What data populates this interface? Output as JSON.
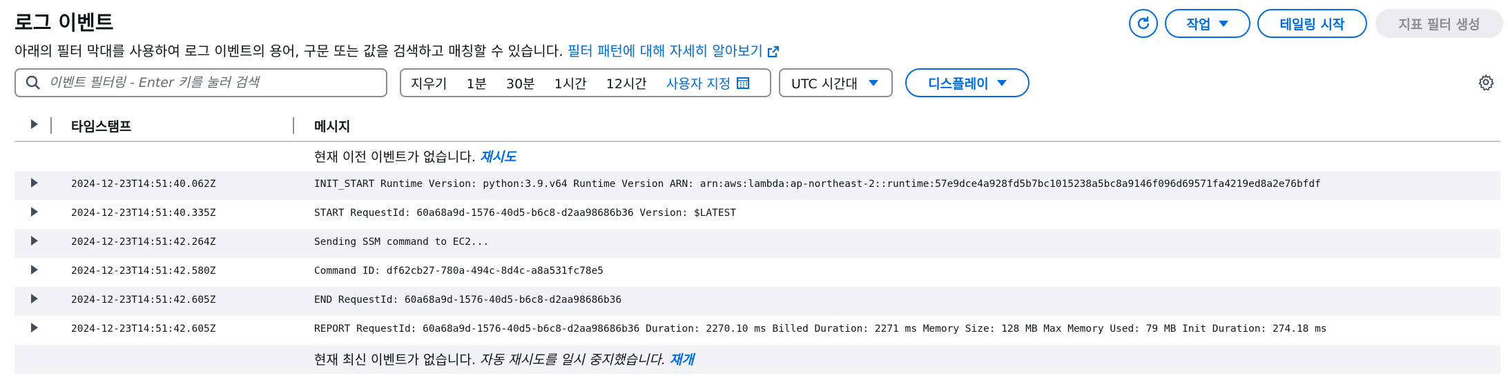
{
  "header": {
    "title": "로그 이벤트",
    "description": "아래의 필터 막대를 사용하여 로그 이벤트의 용어, 구문 또는 값을 검색하고 매칭할 수 있습니다.",
    "learn_more_link": "필터 패턴에 대해 자세히 알아보기"
  },
  "actions": {
    "refresh_icon": "refresh-icon",
    "actions_label": "작업",
    "tailing_label": "테일링 시작",
    "metric_filter_label": "지표 필터 생성"
  },
  "filter": {
    "search_placeholder": "이벤트 필터링 - Enter 키를 눌러 검색",
    "clear": "지우기",
    "ranges": [
      "1분",
      "30분",
      "1시간",
      "12시간"
    ],
    "custom": "사용자 지정",
    "timezone": "UTC 시간대",
    "display": "디스플레이"
  },
  "table": {
    "col_timestamp": "타임스탬프",
    "col_message": "메시지",
    "top_notice": "현재 이전 이벤트가 없습니다.",
    "top_retry": "재시도",
    "rows": [
      {
        "ts": "2024-12-23T14:51:40.062Z",
        "msg": "INIT_START Runtime Version: python:3.9.v64 Runtime Version ARN: arn:aws:lambda:ap-northeast-2::runtime:57e9dce4a928fd5b7bc1015238a5bc8a9146f096d69571fa4219ed8a2e76bfdf"
      },
      {
        "ts": "2024-12-23T14:51:40.335Z",
        "msg": "START RequestId: 60a68a9d-1576-40d5-b6c8-d2aa98686b36 Version: $LATEST"
      },
      {
        "ts": "2024-12-23T14:51:42.264Z",
        "msg": "Sending SSM command to EC2..."
      },
      {
        "ts": "2024-12-23T14:51:42.580Z",
        "msg": "Command ID: df62cb27-780a-494c-8d4c-a8a531fc78e5"
      },
      {
        "ts": "2024-12-23T14:51:42.605Z",
        "msg": "END RequestId: 60a68a9d-1576-40d5-b6c8-d2aa98686b36"
      },
      {
        "ts": "2024-12-23T14:51:42.605Z",
        "msg": "REPORT RequestId: 60a68a9d-1576-40d5-b6c8-d2aa98686b36 Duration: 2270.10 ms Billed Duration: 2271 ms Memory Size: 128 MB Max Memory Used: 79 MB Init Duration: 274.18 ms"
      }
    ],
    "bottom_notice": "현재 최신 이벤트가 없습니다.",
    "bottom_paused": "자동 재시도를 일시 중지했습니다.",
    "bottom_resume": "재개"
  },
  "colors": {
    "accent": "#006ce0",
    "shade": "#f3f3f7",
    "disabled_bg": "#ebebf0"
  }
}
